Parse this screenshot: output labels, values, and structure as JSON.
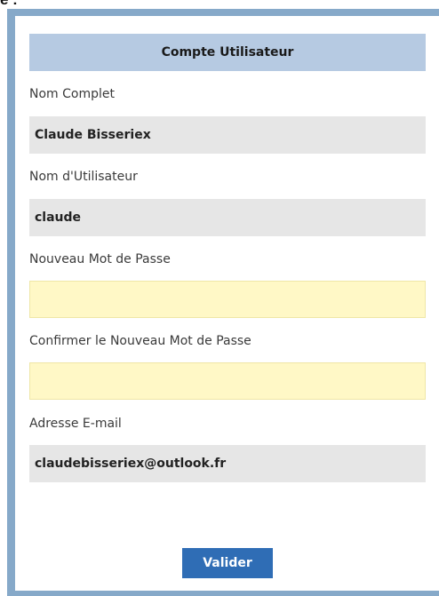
{
  "fragment_text": "e :",
  "form": {
    "title": "Compte Utilisateur",
    "full_name_label": "Nom Complet",
    "full_name_value": "Claude Bisseriex",
    "username_label": "Nom d'Utilisateur",
    "username_value": "claude",
    "new_password_label": "Nouveau Mot de Passe",
    "new_password_value": "",
    "confirm_password_label": "Confirmer le Nouveau Mot de Passe",
    "confirm_password_value": "",
    "email_label": "Adresse E-mail",
    "email_value": "claudebisseriex@outlook.fr",
    "submit_label": "Valider"
  },
  "colors": {
    "frame": "#86a9c9",
    "header": "#b6cae2",
    "readonly_field": "#e6e6e6",
    "password_field": "#fff8c6",
    "button": "#2f6db5"
  }
}
